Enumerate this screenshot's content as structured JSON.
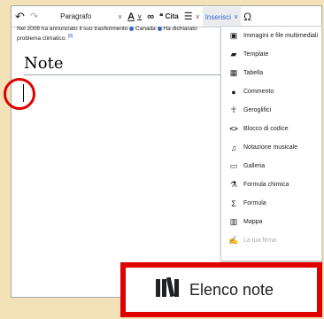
{
  "toolbar": {
    "undo_icon": "undo-icon",
    "redo_icon": "redo-icon",
    "paragraph_label": "Paragrafo",
    "text_style_icon": "A",
    "link_icon": "link-icon",
    "cite_label": "Cita",
    "list_icon": "list-icon",
    "insert_label": "Inserisci",
    "special_char_label": "Ω"
  },
  "article": {
    "text_line1": "Nel 2008 ha annunciato il suo trasferimento",
    "text_link1": "Canada",
    "text_line1b": "Ha dichiarato",
    "text_line2": "problema climatico.",
    "ref": "[8]",
    "heading": "Note"
  },
  "insert_menu": {
    "items": [
      {
        "label": "Immagini e file multimediali",
        "icon": "image-icon",
        "glyph": "▣"
      },
      {
        "label": "Template",
        "icon": "puzzle-icon",
        "glyph": "▰"
      },
      {
        "label": "Tabella",
        "icon": "table-icon",
        "glyph": "▦"
      },
      {
        "label": "Commento",
        "icon": "comment-icon",
        "glyph": "●"
      },
      {
        "label": "Geroglifici",
        "icon": "ankh-icon",
        "glyph": "☥"
      },
      {
        "label": "Blocco di codice",
        "icon": "code-icon",
        "glyph": "<>"
      },
      {
        "label": "Notazione musicale",
        "icon": "music-icon",
        "glyph": "♫"
      },
      {
        "label": "Galleria",
        "icon": "gallery-icon",
        "glyph": "▭"
      },
      {
        "label": "Formula chimica",
        "icon": "flask-icon",
        "glyph": "⚗"
      },
      {
        "label": "Formula",
        "icon": "sigma-icon",
        "glyph": "Σ"
      },
      {
        "label": "Mappa",
        "icon": "map-icon",
        "glyph": "▥"
      },
      {
        "label": "La tua firma",
        "icon": "signature-icon",
        "glyph": "✍"
      }
    ]
  },
  "zoom": {
    "label": "Elenco note",
    "icon": "references-icon"
  },
  "colors": {
    "highlight": "#e00000",
    "link": "#3366cc",
    "background": "#f3e2b8"
  }
}
